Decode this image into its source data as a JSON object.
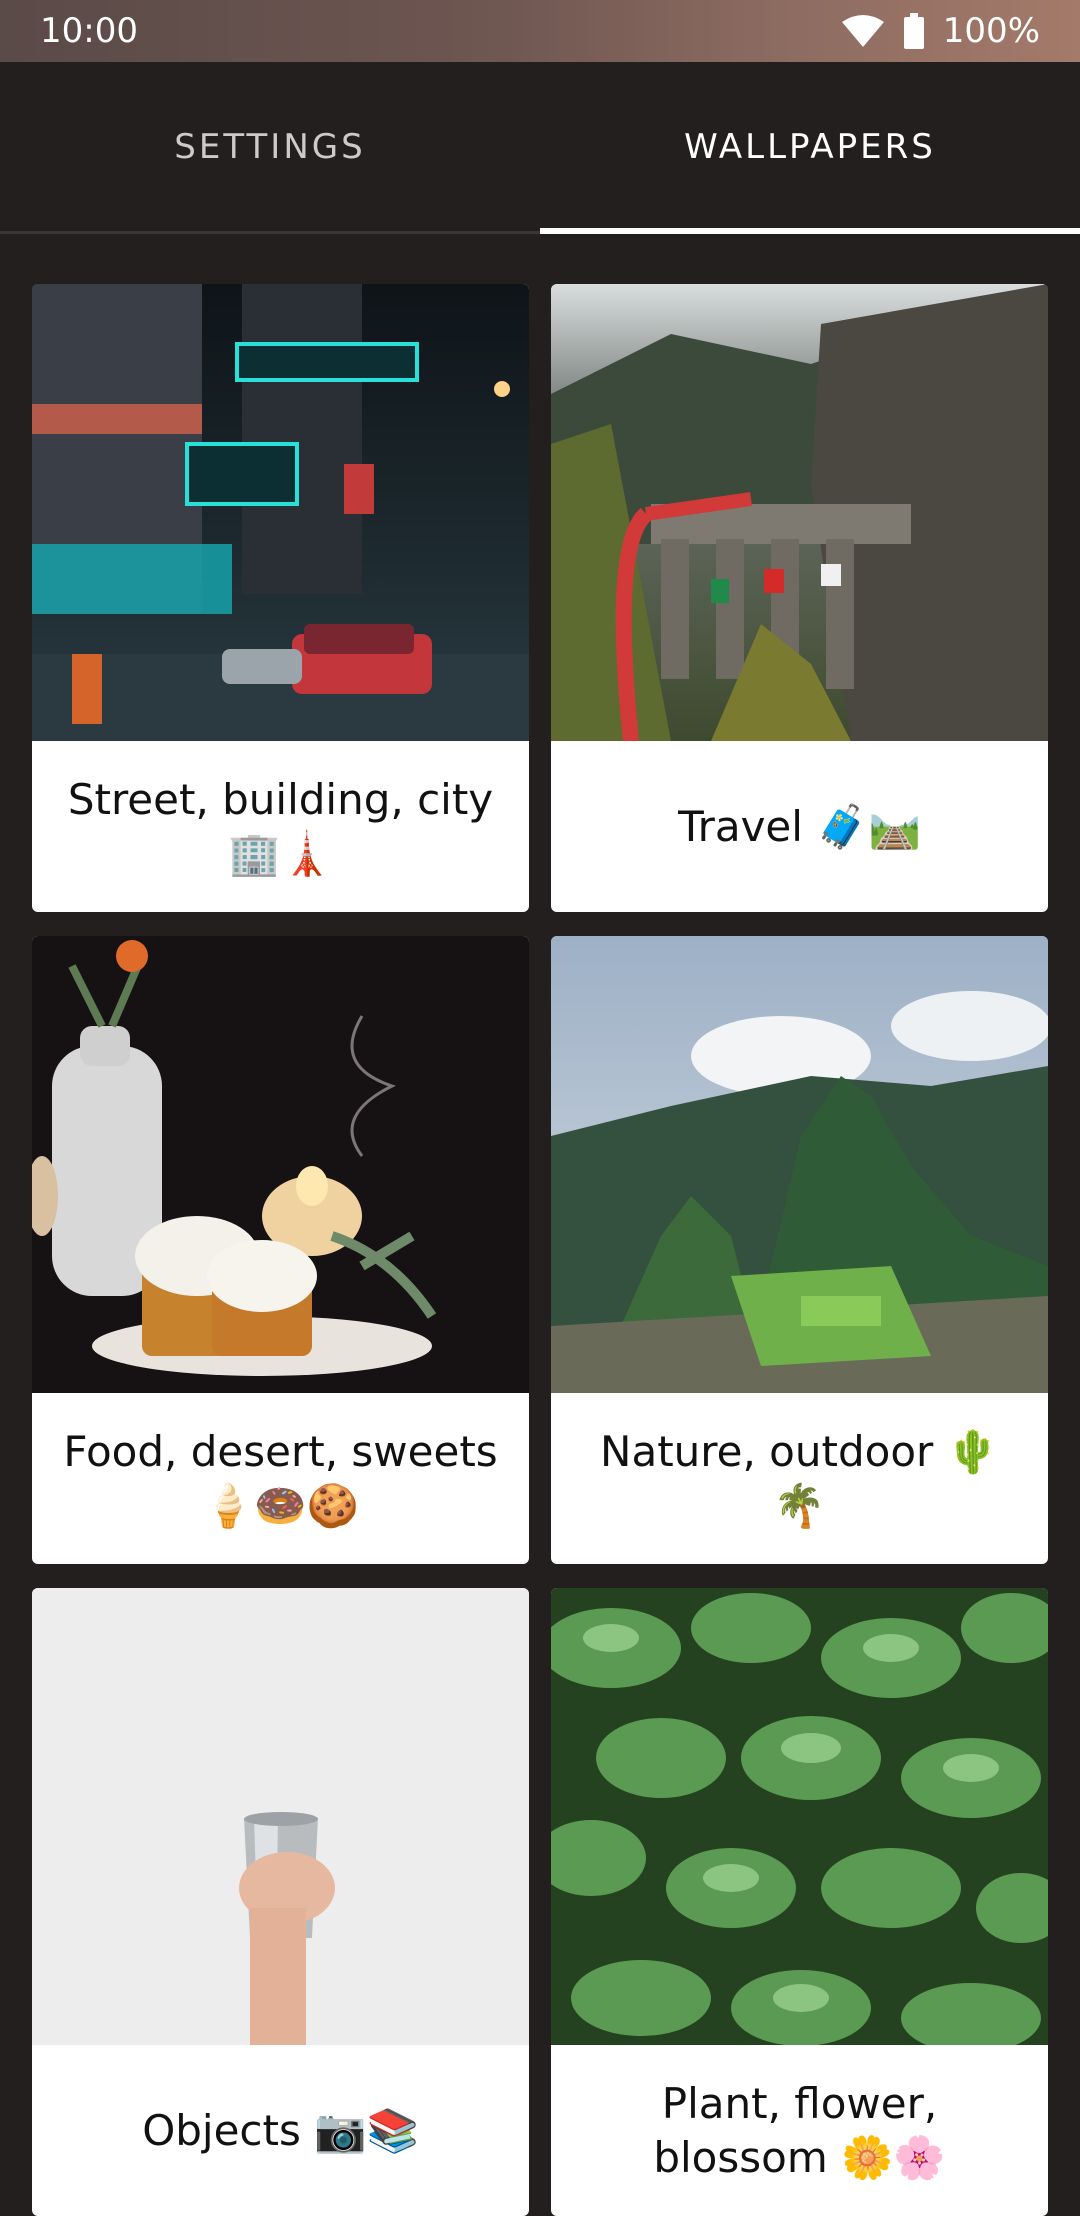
{
  "status_bar": {
    "time": "10:00",
    "battery": "100%",
    "icons": [
      "wifi-icon",
      "battery-icon"
    ]
  },
  "tabs": [
    {
      "label": "SETTINGS",
      "selected": false
    },
    {
      "label": "WALLPAPERS",
      "selected": true
    }
  ],
  "categories": [
    {
      "label": "Street, building, city 🏢🗼",
      "image": "neon-city-street"
    },
    {
      "label": "Travel 🧳🛤️",
      "image": "train-viaduct-mountains"
    },
    {
      "label": "Food, desert, sweets 🍦🍩🍪",
      "image": "cake-candle-dark"
    },
    {
      "label": "Nature, outdoor 🌵🌴",
      "image": "mountain-ruins"
    },
    {
      "label": "Objects 📷📚",
      "image": "hand-holding-cup"
    },
    {
      "label": "Plant, flower, blossom 🌼🌸",
      "image": "green-succulents"
    }
  ]
}
